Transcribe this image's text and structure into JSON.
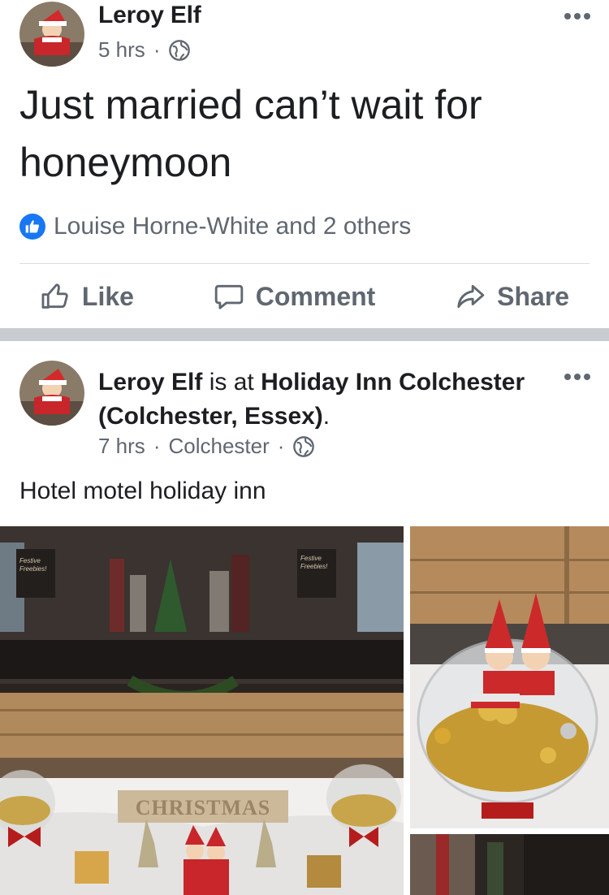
{
  "colors": {
    "link_blue": "#1877f2",
    "secondary_text": "#606770",
    "primary_text": "#1c1e21",
    "separator": "#c9ccd1"
  },
  "post1": {
    "author": "Leroy Elf",
    "time": "5 hrs",
    "privacy_icon": "globe-icon",
    "text": "Just married can’t wait for honeymoon",
    "reactions": {
      "icon": "like-icon",
      "text": "Louise Horne-White and 2 others"
    }
  },
  "post2": {
    "author": "Leroy Elf",
    "checkin_connector": "is at",
    "place": "Holiday Inn Colchester (Colchester, Essex)",
    "punct": ".",
    "time": "7 hrs",
    "location": "Colchester",
    "privacy_icon": "globe-icon",
    "text": "Hotel motel holiday inn",
    "photo_text": {
      "sign_left": "Festive Freebies!",
      "sign_right": "Festive Freebies!",
      "table_banner": "CHRISTMAS"
    }
  },
  "actions": {
    "like": "Like",
    "comment": "Comment",
    "share": "Share"
  }
}
